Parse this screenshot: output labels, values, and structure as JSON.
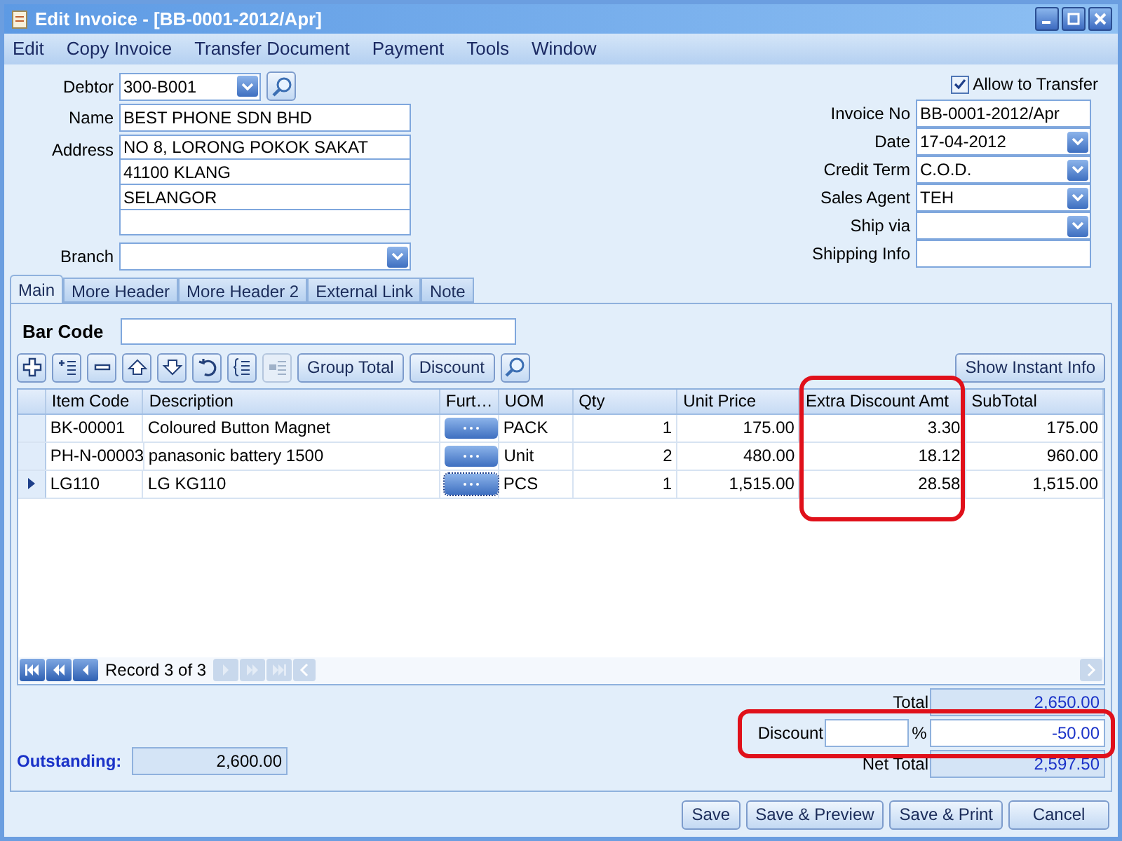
{
  "window": {
    "title": "Edit Invoice - [BB-0001-2012/Apr]"
  },
  "menu": [
    "Edit",
    "Copy Invoice",
    "Transfer Document",
    "Payment",
    "Tools",
    "Window"
  ],
  "debtor": {
    "label": "Debtor",
    "value": "300-B001"
  },
  "name": {
    "label": "Name",
    "value": "BEST PHONE SDN BHD"
  },
  "address": {
    "label": "Address",
    "lines": [
      "NO 8, LORONG POKOK SAKAT",
      "41100 KLANG",
      "SELANGOR"
    ]
  },
  "branch": {
    "label": "Branch"
  },
  "allow_transfer": {
    "label": "Allow to Transfer",
    "checked": true
  },
  "right_fields": [
    {
      "label": "Invoice No",
      "value": "BB-0001-2012/Apr",
      "kind": "text"
    },
    {
      "label": "Date",
      "value": "17-04-2012",
      "kind": "dropdown"
    },
    {
      "label": "Credit Term",
      "value": "C.O.D.",
      "kind": "dropdown"
    },
    {
      "label": "Sales Agent",
      "value": "TEH",
      "kind": "dropdown"
    },
    {
      "label": "Ship via",
      "kind": "dropdown"
    },
    {
      "label": "Shipping Info",
      "kind": "text"
    }
  ],
  "tabs": [
    {
      "label": "Main",
      "selected": true
    },
    {
      "label": "More Header",
      "selected": false
    },
    {
      "label": "More Header 2",
      "selected": false
    },
    {
      "label": "External Link",
      "selected": false
    },
    {
      "label": "Note",
      "selected": false
    }
  ],
  "bar_code": {
    "label": "Bar Code"
  },
  "toolbar_icons": [
    {
      "disabled": false
    },
    {
      "disabled": false
    },
    {
      "disabled": false
    },
    {
      "disabled": false
    },
    {
      "disabled": false
    },
    {
      "disabled": false
    },
    {
      "disabled": false
    },
    {
      "disabled": true
    }
  ],
  "toolbar_buttons": [
    "Group Total",
    "Discount"
  ],
  "show_instant_info": "Show Instant Info",
  "table": {
    "columns": [
      {
        "label": "Item Code",
        "highlighted": false
      },
      {
        "label": "Description",
        "highlighted": false
      },
      {
        "label": "Furt…",
        "highlighted": false
      },
      {
        "label": "UOM",
        "highlighted": false
      },
      {
        "label": "Qty",
        "highlighted": false
      },
      {
        "label": "Unit Price",
        "highlighted": false
      },
      {
        "label": "Extra Discount Amt",
        "highlighted": true
      },
      {
        "label": "SubTotal",
        "highlighted": false
      }
    ],
    "rows": [
      {
        "cells": [
          "BK-00001",
          "Coloured Button Magnet",
          "",
          "PACK",
          "1",
          "175.00",
          "3.30",
          "175.00"
        ],
        "selected": false
      },
      {
        "cells": [
          "PH-N-00003",
          "panasonic battery 1500",
          "",
          "Unit",
          "2",
          "480.00",
          "18.12",
          "960.00"
        ],
        "selected": false
      },
      {
        "cells": [
          "LG110",
          "LG KG110",
          "",
          "PCS",
          "1",
          "1,515.00",
          "28.58",
          "1,515.00"
        ],
        "selected": true
      }
    ]
  },
  "navigator": {
    "record": "Record 3 of 3",
    "back": [
      {
        "disabled": false
      },
      {
        "disabled": false
      },
      {
        "disabled": false
      }
    ],
    "forward": [
      {
        "disabled": true
      },
      {
        "disabled": true
      },
      {
        "disabled": true
      }
    ]
  },
  "totals": {
    "total": {
      "label": "Total",
      "value": "2,650.00"
    },
    "discount": {
      "label": "Discount",
      "percent_sign": "%",
      "value": "-50.00",
      "highlighted": true
    },
    "net_total": {
      "label": "Net Total",
      "value": "2,597.50"
    }
  },
  "outstanding": {
    "label": "Outstanding:",
    "value": "2,600.00"
  },
  "buttons": [
    "Save",
    "Save & Preview",
    "Save & Print",
    "Cancel"
  ]
}
